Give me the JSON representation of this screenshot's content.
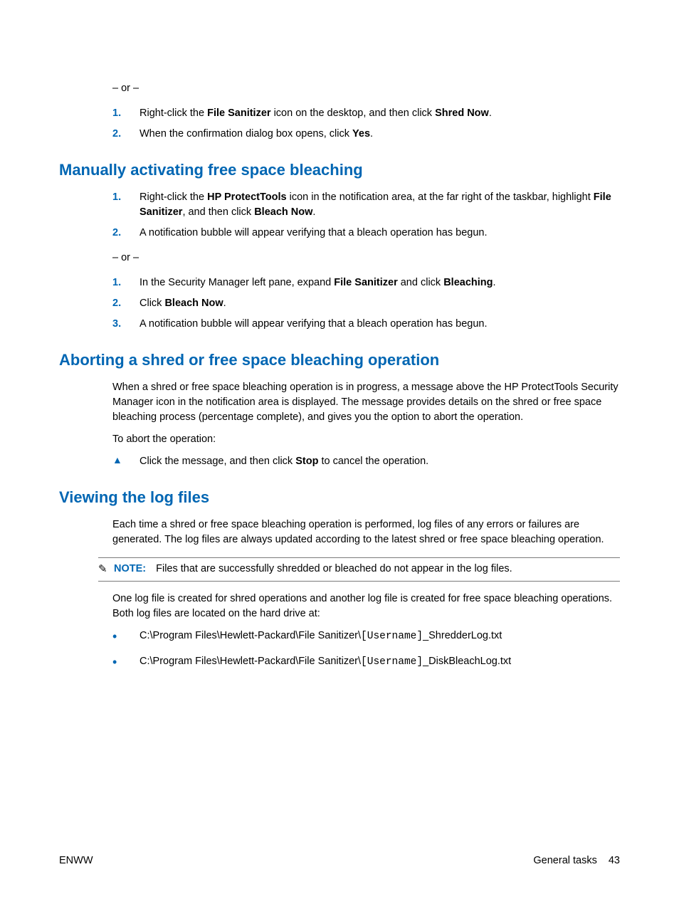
{
  "orText": "– or –",
  "sec0": {
    "listA": [
      {
        "num": "1.",
        "pre": "Right-click the ",
        "b1": "File Sanitizer",
        "mid": " icon on the desktop, and then click ",
        "b2": "Shred Now",
        "post": "."
      },
      {
        "num": "2.",
        "pre": "When the confirmation dialog box opens, click ",
        "b1": "Yes",
        "mid": "",
        "b2": "",
        "post": "."
      }
    ]
  },
  "sec1": {
    "heading": "Manually activating free space bleaching",
    "listA": [
      {
        "num": "1.",
        "pre": "Right-click the ",
        "b1": "HP ProtectTools",
        "mid": " icon in the notification area, at the far right of the taskbar, highlight ",
        "b2": "File Sanitizer",
        "mid2": ", and then click ",
        "b3": "Bleach Now",
        "post": "."
      },
      {
        "num": "2.",
        "pre": "A notification bubble will appear verifying that a bleach operation has begun.",
        "b1": "",
        "mid": "",
        "b2": "",
        "post": ""
      }
    ],
    "listB": [
      {
        "num": "1.",
        "pre": "In the Security Manager left pane, expand ",
        "b1": "File Sanitizer",
        "mid": " and click ",
        "b2": "Bleaching",
        "post": "."
      },
      {
        "num": "2.",
        "pre": "Click ",
        "b1": "Bleach Now",
        "mid": "",
        "b2": "",
        "post": "."
      },
      {
        "num": "3.",
        "pre": "A notification bubble will appear verifying that a bleach operation has begun.",
        "b1": "",
        "mid": "",
        "b2": "",
        "post": ""
      }
    ]
  },
  "sec2": {
    "heading": "Aborting a shred or free space bleaching operation",
    "para1": "When a shred or free space bleaching operation is in progress, a message above the HP ProtectTools Security Manager icon in the notification area is displayed. The message provides details on the shred or free space bleaching process (percentage complete), and gives you the option to abort the operation.",
    "para2": "To abort the operation:",
    "tri": {
      "pre": "Click the message, and then click ",
      "b1": "Stop",
      "post": " to cancel the operation."
    }
  },
  "sec3": {
    "heading": "Viewing the log files",
    "para1": "Each time a shred or free space bleaching operation is performed, log files of any errors or failures are generated. The log files are always updated according to the latest shred or free space bleaching operation.",
    "noteLabel": "NOTE:",
    "noteText": "Files that are successfully shredded or bleached do not appear in the log files.",
    "para2": "One log file is created for shred operations and another log file is created for free space bleaching operations. Both log files are located on the hard drive at:",
    "bullets": [
      {
        "pre": "C:\\Program Files\\Hewlett-Packard\\File Sanitizer\\",
        "mono": "[Username]",
        "post": "_ShredderLog.txt"
      },
      {
        "pre": "C:\\Program Files\\Hewlett-Packard\\File Sanitizer\\",
        "mono": "[Username]",
        "post": "_DiskBleachLog.txt"
      }
    ]
  },
  "footer": {
    "left": "ENWW",
    "rightLabel": "General tasks",
    "pageNum": "43"
  }
}
